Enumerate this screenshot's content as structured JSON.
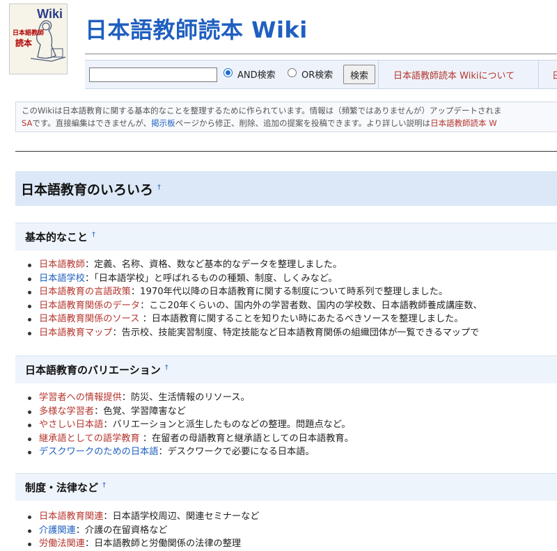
{
  "logo": {
    "wiki": "Wiki",
    "sub1": "日本語教師",
    "sub2": "読本"
  },
  "site_title": "日本語教師読本 Wiki",
  "toolbar": {
    "search_value": "",
    "and_label": "AND検索",
    "or_label": "OR検索",
    "search_button": "検索",
    "about_link": "日本語教師読本 Wikiについて",
    "next_link_partial": "日"
  },
  "notice": {
    "line1": "このWikiは日本語教育に関する基本的なことを整理するために作られています。情報は（頻繁ではありませんが）アップデートされま",
    "line2_a": "SA",
    "line2_b": "です。直接編集はできませんが、",
    "bbs_link": "掲示板",
    "line2_c": "ページから修正、削除、追加の提案を投稿できます。より詳しい説明は",
    "about_link": "日本語教師読本 W"
  },
  "main_heading": "日本語教育のいろいろ",
  "anchor": "†",
  "sections": [
    {
      "heading": "基本的なこと",
      "items": [
        {
          "link": "日本語教師",
          "color": "red",
          "text": "：定義、名称、資格、数など基本的なデータを整理しました。"
        },
        {
          "link": "日本語学校",
          "color": "blue",
          "text": "：「日本語学校」と呼ばれるものの種類、制度、しくみなど。"
        },
        {
          "link": "日本語教育の言語政策",
          "color": "red",
          "text": "：1970年代以降の日本語教育に関する制度について時系列で整理しました。"
        },
        {
          "link": "日本語教育関係のデータ",
          "color": "red",
          "text": "：ここ20年くらいの、国内外の学習者数、国内の学校数、日本語教師養成講座数、"
        },
        {
          "link": "日本語教育関係のソース",
          "color": "red",
          "text": " ：日本語教育に関することを知りたい時にあたるべきソースを整理しました。"
        },
        {
          "link": "日本語教育マップ",
          "color": "red",
          "text": "：告示校、技能実習制度、特定技能など日本語教育関係の組織団体が一覧できるマップで"
        }
      ]
    },
    {
      "heading": "日本語教育のバリエーション",
      "items": [
        {
          "link": "学習者への情報提供",
          "color": "red",
          "text": "：防災、生活情報のリソース。"
        },
        {
          "link": "多様な学習者",
          "color": "red",
          "text": "：色覚、学習障害など"
        },
        {
          "link": "やさしい日本語",
          "color": "red",
          "text": "：バリエーションと派生したものなどの整理。問題点など。"
        },
        {
          "link": "継承語としての語学教育",
          "color": "red",
          "text": " ：在留者の母語教育と継承語としての日本語教育。"
        },
        {
          "link": "デスクワークのための日本語",
          "color": "blue",
          "text": "：デスクワークで必要になる日本語。"
        }
      ]
    },
    {
      "heading": "制度・法律など",
      "items": [
        {
          "link": "日本語教育関連",
          "color": "red",
          "text": "：日本語学校周辺、関連セミナーなど"
        },
        {
          "link": "介護関連",
          "color": "blue",
          "text": "：介護の在留資格など"
        },
        {
          "link": "労働法関連",
          "color": "red",
          "text": "：日本語教師と労働関係の法律の整理"
        }
      ]
    }
  ],
  "colors": {
    "title_blue": "#1f5fc0",
    "link_red": "#b5362e",
    "heading_bg": "#dce8f7"
  }
}
